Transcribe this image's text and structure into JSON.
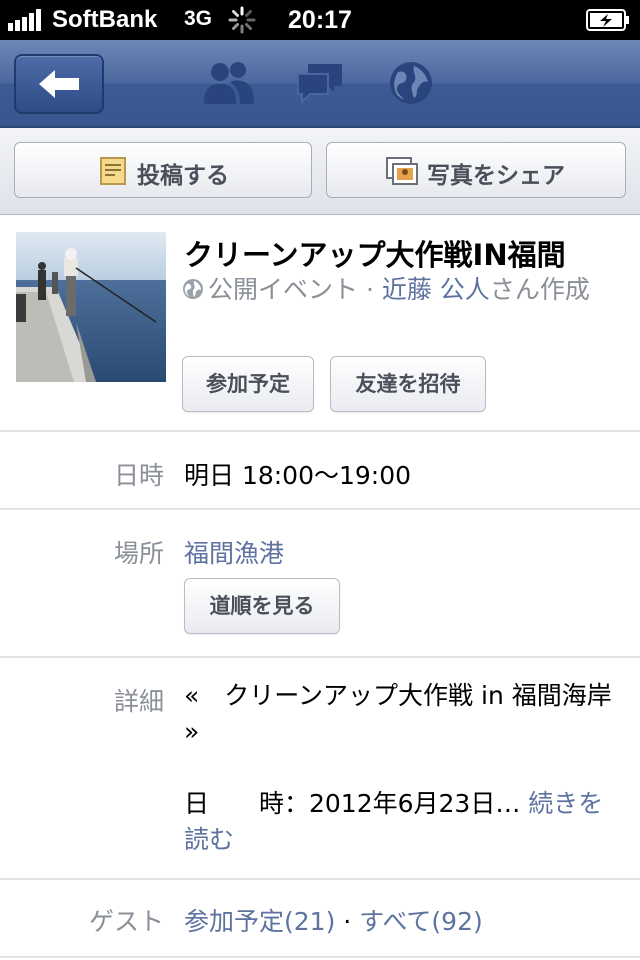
{
  "status_bar": {
    "carrier": "SoftBank",
    "network": "3G",
    "time": "20:17"
  },
  "nav": {
    "icons": [
      "back-arrow-icon",
      "friends-icon",
      "messages-icon",
      "globe-icon"
    ]
  },
  "actions": {
    "post_label": "投稿する",
    "share_photo_label": "写真をシェア"
  },
  "event": {
    "title": "クリーンアップ大作戦IN福間",
    "visibility": "公開イベント",
    "separator": " · ",
    "host": "近藤 公人",
    "host_suffix": "さん作成",
    "going_button": "参加予定",
    "invite_button": "友達を招待"
  },
  "datetime": {
    "label": "日時",
    "value": "明日 18:00〜19:00"
  },
  "location": {
    "label": "場所",
    "value": "福間漁港",
    "directions_button": "道順を見る"
  },
  "details": {
    "label": "詳細",
    "line1": "«　クリーンアップ大作戦 in 福間海岸 »",
    "line2": "日　　時：2012年6月23日…",
    "more_link": "続きを読む"
  },
  "guests": {
    "label": "ゲスト",
    "going": "参加予定(21)",
    "separator": " · ",
    "all": "すべて(92)"
  }
}
